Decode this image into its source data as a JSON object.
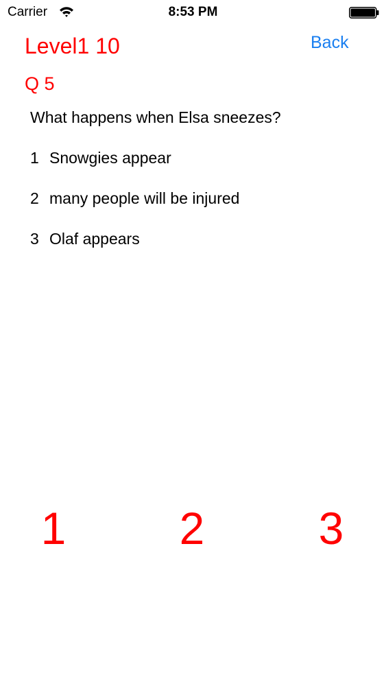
{
  "status_bar": {
    "carrier": "Carrier",
    "time": "8:53 PM",
    "wifi_icon": "wifi-icon",
    "battery_icon": "battery-full-icon"
  },
  "header": {
    "level_title": "Level1 10",
    "back_label": "Back"
  },
  "quiz": {
    "question_number": "Q 5",
    "question": "What happens when Elsa sneezes?",
    "options": [
      {
        "number": "1",
        "text": "Snowgies appear"
      },
      {
        "number": "2",
        "text": "many people will be injured"
      },
      {
        "number": "3",
        "text": "Olaf appears"
      }
    ]
  },
  "answer_buttons": [
    "1",
    "2",
    "3"
  ],
  "colors": {
    "accent_red": "#ff0000",
    "link_blue": "#1a7ff0",
    "text": "#000000",
    "background": "#ffffff"
  }
}
